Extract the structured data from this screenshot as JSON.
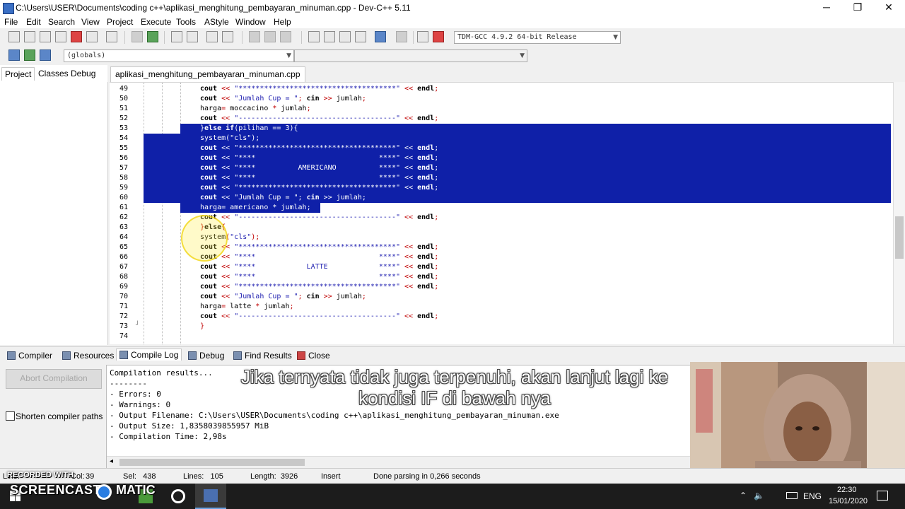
{
  "window": {
    "title": "C:\\Users\\USER\\Documents\\coding c++\\aplikasi_menghitung_pembayaran_minuman.cpp - Dev-C++ 5.11",
    "minimize": "─",
    "maximize": "❐",
    "close": "✕"
  },
  "menu": [
    "File",
    "Edit",
    "Search",
    "View",
    "Project",
    "Execute",
    "Tools",
    "AStyle",
    "Window",
    "Help"
  ],
  "toolbar": {
    "compiler_select": "TDM-GCC 4.9.2 64-bit Release",
    "scope_select": "(globals)",
    "member_select": ""
  },
  "left_panel": {
    "tabs": [
      "Project",
      "Classes",
      "Debug"
    ],
    "active_tab": "Project"
  },
  "editor": {
    "tab_label": "aplikasi_menghitung_pembayaran_minuman.cpp",
    "lines": [
      {
        "n": "49",
        "text": "cout << \"*************************************\" << endl;",
        "sel": false
      },
      {
        "n": "50",
        "text": "cout << \"Jumlah Cup = \"; cin >> jumlah;",
        "sel": false
      },
      {
        "n": "51",
        "text": "harga= moccacino * jumlah;",
        "sel": false
      },
      {
        "n": "52",
        "text": "cout << \"-------------------------------------\" << endl;",
        "sel": false
      },
      {
        "n": "53",
        "text": "}else if(pilihan == 3){",
        "sel": true,
        "indent": 0
      },
      {
        "n": "54",
        "text": "system(\"cls\");",
        "sel": true
      },
      {
        "n": "55",
        "text": "cout << \"*************************************\" << endl;",
        "sel": true
      },
      {
        "n": "56",
        "text": "cout << \"****                             ****\" << endl;",
        "sel": true
      },
      {
        "n": "57",
        "text": "cout << \"****          AMERICANO          ****\" << endl;",
        "sel": true
      },
      {
        "n": "58",
        "text": "cout << \"****                             ****\" << endl;",
        "sel": true
      },
      {
        "n": "59",
        "text": "cout << \"*************************************\" << endl;",
        "sel": true
      },
      {
        "n": "60",
        "text": "cout << \"Jumlah Cup = \"; cin >> jumlah;",
        "sel": true
      },
      {
        "n": "61",
        "text": "harga= americano * jumlah;",
        "sel": true,
        "partial": true
      },
      {
        "n": "62",
        "text": "cout << \"-------------------------------------\" << endl;",
        "sel": false
      },
      {
        "n": "63",
        "text": "}else{",
        "sel": false
      },
      {
        "n": "64",
        "text": "system(\"cls\");",
        "sel": false
      },
      {
        "n": "65",
        "text": "cout << \"*************************************\" << endl;",
        "sel": false
      },
      {
        "n": "66",
        "text": "cout << \"****                             ****\" << endl;",
        "sel": false
      },
      {
        "n": "67",
        "text": "cout << \"****            LATTE            ****\" << endl;",
        "sel": false
      },
      {
        "n": "68",
        "text": "cout << \"****                             ****\" << endl;",
        "sel": false
      },
      {
        "n": "69",
        "text": "cout << \"*************************************\" << endl;",
        "sel": false
      },
      {
        "n": "70",
        "text": "cout << \"Jumlah Cup = \"; cin >> jumlah;",
        "sel": false
      },
      {
        "n": "71",
        "text": "harga= latte * jumlah;",
        "sel": false
      },
      {
        "n": "72",
        "text": "cout << \"-------------------------------------\" << endl;",
        "sel": false
      },
      {
        "n": "73",
        "text": "}",
        "sel": false
      },
      {
        "n": "74",
        "text": "",
        "sel": false
      }
    ]
  },
  "bottom_tabs": [
    {
      "label": "Compiler",
      "active": false
    },
    {
      "label": "Resources",
      "active": false
    },
    {
      "label": "Compile Log",
      "active": true
    },
    {
      "label": "Debug",
      "active": false
    },
    {
      "label": "Find Results",
      "active": false
    },
    {
      "label": "Close",
      "active": false
    }
  ],
  "compile_panel": {
    "abort_label": "Abort Compilation",
    "shorten_label": "Shorten compiler paths",
    "log": [
      "Compilation results...",
      "--------",
      "- Errors: 0",
      "- Warnings: 0",
      "- Output Filename: C:\\Users\\USER\\Documents\\coding c++\\aplikasi_menghitung_pembayaran_minuman.exe",
      "- Output Size: 1,8358039855957 MiB",
      "- Compilation Time: 2,98s"
    ]
  },
  "caption": {
    "line1": "Jika ternyata tidak juga terpenuhi, akan lanjut lagi ke",
    "line2": "kondisi IF di bawah nya"
  },
  "statusbar": {
    "line_label": "Line:",
    "col_label": "Col:",
    "col_value": "39",
    "sel": "Sel:   438",
    "lines": "Lines:   105",
    "length": "Length:  3926",
    "mode": "Insert",
    "parse": "Done parsing in 0,266 seconds"
  },
  "watermark": {
    "recorded": "RECORDED WITH",
    "brand_left": "SCREENCAST",
    "brand_right": "MATIC"
  },
  "taskbar": {
    "lang": "ENG",
    "time": "22:30",
    "date": "15/01/2020"
  },
  "colors": {
    "selection": "#0f20a8",
    "string": "#1f1fb0",
    "operator": "#c00000"
  }
}
